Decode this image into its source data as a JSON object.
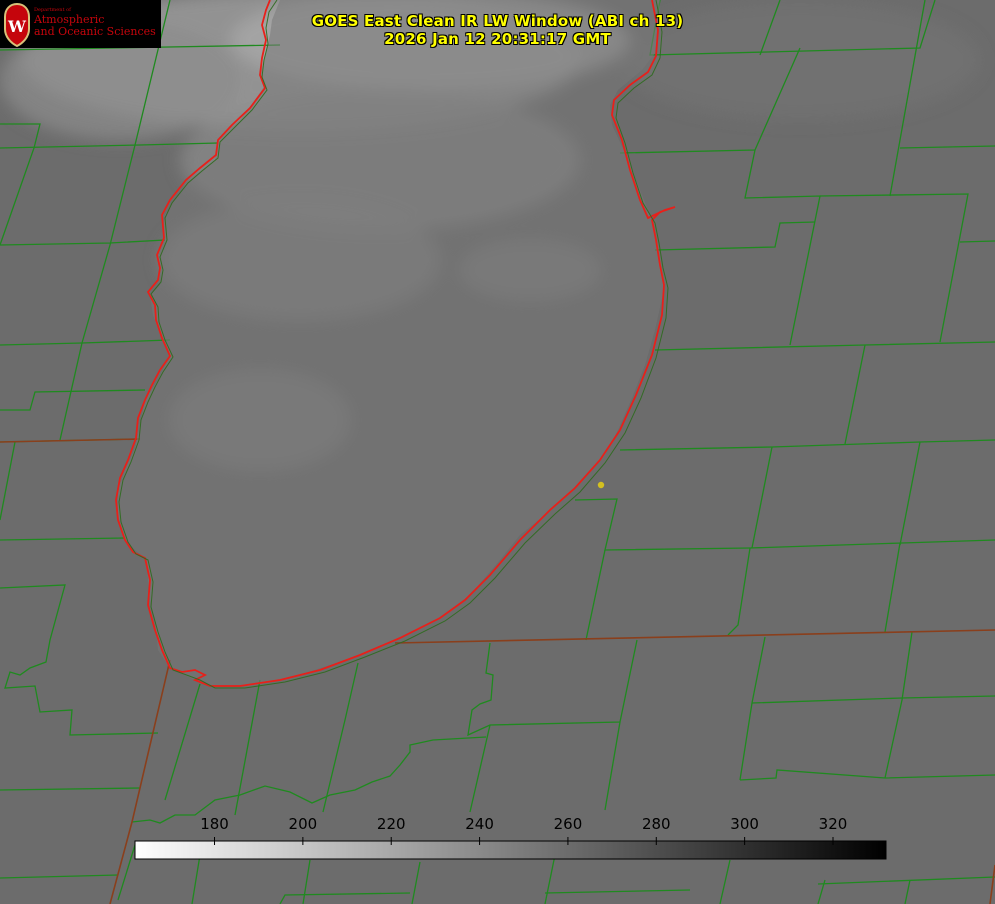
{
  "logo": {
    "department": "Department of",
    "line1": "Atmospheric",
    "line2": "and Oceanic Sciences",
    "shield_letter": "W",
    "color": "#c5050c"
  },
  "title": {
    "line1": "GOES East Clean IR LW Window (ABI ch 13)",
    "line2": "2026 Jan 12 20:31:17 GMT",
    "color": "#ffff00"
  },
  "colorbar": {
    "ticks": [
      "180",
      "200",
      "220",
      "240",
      "260",
      "280",
      "300",
      "320"
    ],
    "range": [
      162,
      332
    ],
    "gradient": [
      "#ffffff",
      "#000000"
    ]
  },
  "map_colors": {
    "county_lines": "#1f8a1f",
    "lake_outline": "#e8201a",
    "marker": "#d4c020"
  }
}
